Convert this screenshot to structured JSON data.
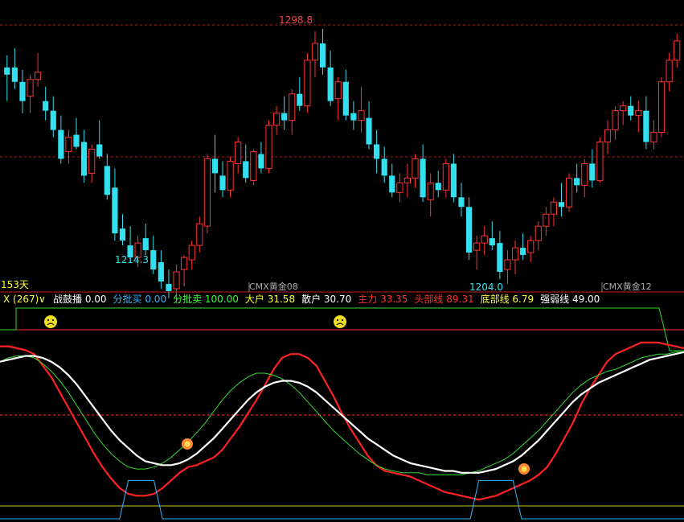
{
  "candles_panel": {
    "price_labels": {
      "high": "1298.8",
      "low_left": "1214.3",
      "low_right": "1204.0"
    },
    "day_count": "153天",
    "contract_left": "CMX黄金08",
    "contract_right": "CMX黄金12"
  },
  "indicator_header": {
    "name": "X (267)",
    "dropdown_glyph": "∨",
    "items": [
      {
        "label": "战鼓播",
        "value": "0.00",
        "color": "#ffffff"
      },
      {
        "label": "分批买",
        "value": "0.00",
        "color": "#33b5ff"
      },
      {
        "label": "分批卖",
        "value": "100.00",
        "color": "#33ff33"
      },
      {
        "label": "大户",
        "value": "31.58",
        "color": "#ffff33"
      },
      {
        "label": "散户",
        "value": "30.70",
        "color": "#ffffff"
      },
      {
        "label": "主力",
        "value": "33.35",
        "color": "#ff3333"
      },
      {
        "label": "头部线",
        "value": "89.31",
        "color": "#ff3333"
      },
      {
        "label": "底部线",
        "value": "6.79",
        "color": "#ffff33"
      },
      {
        "label": "强弱线",
        "value": "49.00",
        "color": "#ffffff"
      }
    ]
  },
  "markers": {
    "sad_face": "sad-face-icon",
    "flame": "flame-icon"
  },
  "colors": {
    "up": "#ff3333",
    "down": "#33e0f0",
    "bg": "#000000"
  },
  "chart_data": [
    {
      "type": "candlestick",
      "title": "CMX黄金",
      "y_range": [
        1200,
        1302
      ],
      "candles": [
        [
          1284,
          1289,
          1270,
          1281
        ],
        [
          1284,
          1292,
          1275,
          1278
        ],
        [
          1278,
          1283,
          1265,
          1270
        ],
        [
          1272,
          1281,
          1265,
          1279
        ],
        [
          1279,
          1290,
          1276,
          1282
        ],
        [
          1270,
          1276,
          1262,
          1266
        ],
        [
          1266,
          1272,
          1255,
          1258
        ],
        [
          1258,
          1264,
          1244,
          1246
        ],
        [
          1249,
          1258,
          1244,
          1255
        ],
        [
          1256,
          1263,
          1250,
          1251
        ],
        [
          1253,
          1258,
          1236,
          1239
        ],
        [
          1240,
          1252,
          1236,
          1250
        ],
        [
          1252,
          1262,
          1246,
          1247
        ],
        [
          1243,
          1248,
          1229,
          1231
        ],
        [
          1234,
          1242,
          1212,
          1215
        ],
        [
          1217,
          1223,
          1210,
          1212
        ],
        [
          1210,
          1218,
          1203,
          1205
        ],
        [
          1205,
          1214,
          1201,
          1211
        ],
        [
          1213,
          1219,
          1206,
          1208
        ],
        [
          1208,
          1214,
          1198,
          1200
        ],
        [
          1203,
          1208,
          1192,
          1195
        ],
        [
          1194,
          1200,
          1188,
          1191
        ],
        [
          1192,
          1202,
          1186,
          1199
        ],
        [
          1200,
          1206,
          1193,
          1205
        ],
        [
          1204,
          1212,
          1200,
          1210
        ],
        [
          1210,
          1222,
          1207,
          1219
        ],
        [
          1218,
          1248,
          1215,
          1246
        ],
        [
          1246,
          1256,
          1232,
          1240
        ],
        [
          1239,
          1245,
          1230,
          1233
        ],
        [
          1233,
          1247,
          1230,
          1245
        ],
        [
          1244,
          1255,
          1240,
          1253
        ],
        [
          1245,
          1252,
          1236,
          1238
        ],
        [
          1237,
          1250,
          1235,
          1249
        ],
        [
          1248,
          1253,
          1240,
          1242
        ],
        [
          1242,
          1262,
          1240,
          1260
        ],
        [
          1260,
          1268,
          1256,
          1265
        ],
        [
          1265,
          1272,
          1258,
          1262
        ],
        [
          1262,
          1275,
          1256,
          1273
        ],
        [
          1273,
          1280,
          1266,
          1268
        ],
        [
          1268,
          1290,
          1265,
          1287
        ],
        [
          1287,
          1299,
          1280,
          1294
        ],
        [
          1294,
          1300,
          1281,
          1284
        ],
        [
          1284,
          1291,
          1268,
          1270
        ],
        [
          1271,
          1280,
          1262,
          1278
        ],
        [
          1278,
          1283,
          1262,
          1264
        ],
        [
          1265,
          1270,
          1258,
          1262
        ],
        [
          1262,
          1276,
          1257,
          1266
        ],
        [
          1263,
          1270,
          1250,
          1252
        ],
        [
          1252,
          1258,
          1240,
          1246
        ],
        [
          1246,
          1251,
          1236,
          1239
        ],
        [
          1239,
          1244,
          1230,
          1232
        ],
        [
          1232,
          1240,
          1228,
          1236
        ],
        [
          1236,
          1244,
          1230,
          1238
        ],
        [
          1238,
          1248,
          1234,
          1246
        ],
        [
          1246,
          1252,
          1228,
          1230
        ],
        [
          1229,
          1240,
          1222,
          1236
        ],
        [
          1236,
          1241,
          1230,
          1233
        ],
        [
          1233,
          1246,
          1230,
          1244
        ],
        [
          1244,
          1248,
          1228,
          1230
        ],
        [
          1230,
          1236,
          1222,
          1226
        ],
        [
          1226,
          1230,
          1204,
          1207
        ],
        [
          1208,
          1214,
          1200,
          1211
        ],
        [
          1211,
          1218,
          1206,
          1214
        ],
        [
          1213,
          1220,
          1208,
          1210
        ],
        [
          1211,
          1216,
          1196,
          1199
        ],
        [
          1200,
          1208,
          1194,
          1204
        ],
        [
          1204,
          1212,
          1198,
          1209
        ],
        [
          1209,
          1215,
          1204,
          1206
        ],
        [
          1207,
          1214,
          1203,
          1212
        ],
        [
          1212,
          1220,
          1208,
          1218
        ],
        [
          1218,
          1226,
          1214,
          1223
        ],
        [
          1223,
          1230,
          1218,
          1228
        ],
        [
          1228,
          1236,
          1222,
          1226
        ],
        [
          1226,
          1240,
          1224,
          1238
        ],
        [
          1238,
          1244,
          1232,
          1235
        ],
        [
          1235,
          1246,
          1230,
          1244
        ],
        [
          1244,
          1250,
          1234,
          1237
        ],
        [
          1237,
          1255,
          1236,
          1253
        ],
        [
          1253,
          1262,
          1248,
          1258
        ],
        [
          1258,
          1268,
          1254,
          1266
        ],
        [
          1266,
          1270,
          1260,
          1268
        ],
        [
          1268,
          1272,
          1262,
          1264
        ],
        [
          1264,
          1270,
          1257,
          1266
        ],
        [
          1266,
          1272,
          1250,
          1253
        ],
        [
          1253,
          1262,
          1250,
          1257
        ],
        [
          1257,
          1280,
          1255,
          1278
        ],
        [
          1278,
          1290,
          1274,
          1287
        ],
        [
          1287,
          1298,
          1284,
          1295
        ]
      ]
    },
    {
      "type": "line",
      "title": "X (267)",
      "y_range": [
        0,
        110
      ],
      "levels": [
        {
          "name": "头部线",
          "value": 89.31
        },
        {
          "name": "底部线",
          "value": 6.79
        },
        {
          "name": "强弱线",
          "value": 49.0
        }
      ],
      "series": [
        {
          "name": "主力",
          "color": "#ff2222",
          "values": [
            90,
            90,
            89,
            88,
            86,
            80,
            74,
            66,
            58,
            50,
            42,
            34,
            27,
            21,
            16,
            13,
            12,
            12,
            13,
            16,
            20,
            24,
            27,
            28,
            30,
            32,
            36,
            42,
            48,
            55,
            62,
            70,
            78,
            84,
            86,
            86,
            84,
            80,
            72,
            64,
            55,
            47,
            40,
            33,
            28,
            25,
            24,
            23,
            22,
            20,
            18,
            16,
            14,
            13,
            12,
            11,
            10,
            11,
            12,
            14,
            16,
            18,
            20,
            23,
            27,
            34,
            42,
            50,
            60,
            68,
            75,
            82,
            86,
            88,
            90,
            92,
            92,
            92,
            91,
            90,
            89
          ]
        },
        {
          "name": "散户",
          "color": "#33dd33",
          "values": [
            82,
            84,
            85,
            85,
            84,
            81,
            77,
            72,
            66,
            59,
            52,
            45,
            39,
            34,
            30,
            27,
            26,
            26,
            27,
            29,
            32,
            36,
            40,
            45,
            50,
            56,
            62,
            67,
            71,
            74,
            76,
            76,
            75,
            73,
            70,
            66,
            61,
            56,
            51,
            46,
            42,
            38,
            34,
            31,
            28,
            26,
            25,
            24,
            24,
            24,
            23,
            23,
            23,
            23,
            23,
            24,
            25,
            27,
            29,
            31,
            34,
            38,
            42,
            46,
            51,
            56,
            61,
            66,
            70,
            73,
            75,
            77,
            78,
            80,
            82,
            84,
            85,
            86,
            86,
            87,
            87
          ]
        },
        {
          "name": "大户",
          "color": "#ffffff",
          "values": [
            82,
            83,
            84,
            85,
            85,
            84,
            82,
            79,
            75,
            70,
            64,
            58,
            52,
            46,
            41,
            37,
            33,
            30,
            29,
            28,
            28,
            29,
            31,
            34,
            38,
            42,
            47,
            52,
            57,
            62,
            66,
            69,
            71,
            72,
            72,
            71,
            69,
            66,
            62,
            58,
            54,
            50,
            46,
            42,
            39,
            36,
            33,
            31,
            29,
            28,
            27,
            26,
            25,
            25,
            24,
            24,
            24,
            25,
            26,
            28,
            30,
            33,
            37,
            41,
            46,
            51,
            56,
            61,
            65,
            68,
            71,
            73,
            75,
            77,
            79,
            81,
            83,
            84,
            85,
            86,
            87
          ]
        },
        {
          "name": "分批买",
          "color": "#33b5ff",
          "values": [
            0,
            0,
            0,
            0,
            0,
            0,
            0,
            0,
            0,
            0,
            0,
            0,
            0,
            0,
            0,
            20,
            20,
            20,
            20,
            0,
            0,
            0,
            0,
            0,
            0,
            0,
            0,
            0,
            0,
            0,
            0,
            0,
            0,
            0,
            0,
            0,
            0,
            0,
            0,
            0,
            0,
            0,
            0,
            0,
            0,
            0,
            0,
            0,
            0,
            0,
            0,
            0,
            0,
            0,
            0,
            0,
            20,
            20,
            20,
            20,
            20,
            0,
            0,
            0,
            0,
            0,
            0,
            0,
            0,
            0,
            0,
            0,
            0,
            0,
            0,
            0,
            0,
            0,
            0,
            0,
            0
          ]
        }
      ]
    }
  ]
}
